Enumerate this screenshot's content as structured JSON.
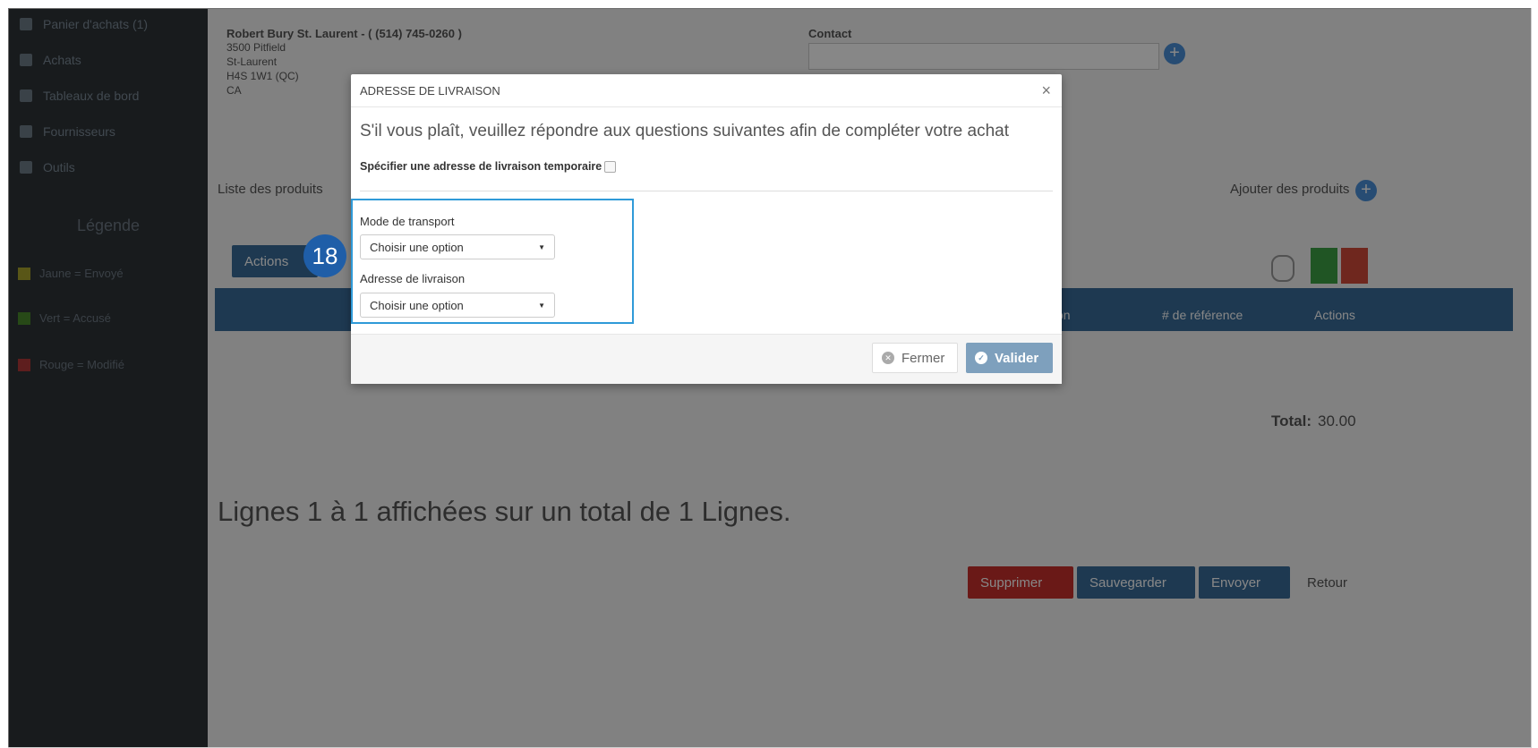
{
  "sidebar": {
    "items": [
      {
        "label": "Panier d'achats (1)",
        "icon": "cart-icon"
      },
      {
        "label": "Achats",
        "icon": "list-icon"
      },
      {
        "label": "Tableaux de bord",
        "icon": "dashboard-icon"
      },
      {
        "label": "Fournisseurs",
        "icon": "building-icon"
      },
      {
        "label": "Outils",
        "icon": "tools-icon"
      }
    ],
    "legend_title": "Légende",
    "legend": [
      {
        "label": "Jaune = Envoyé",
        "color": "#a8a22c"
      },
      {
        "label": "Vert = Accusé",
        "color": "#4a8a2c"
      },
      {
        "label": "Rouge = Modifié",
        "color": "#b23a3a"
      }
    ]
  },
  "background": {
    "supplier_name": "Robert Bury St. Laurent - ( (514) 745-0260 )",
    "supplier_address": [
      "3500 Pitfield",
      "St-Laurent",
      "H4S 1W1 (QC)",
      "CA"
    ],
    "contact_label": "Contact",
    "products_list_label": "Liste des produits",
    "add_products_label": "Ajouter des produits",
    "actions_label": "Actions",
    "col_reference": "# de référence",
    "col_actions": "Actions",
    "col_partial": "on",
    "total_label": "Total:",
    "total_value": "30.00",
    "lines_summary": "Lignes 1 à 1 affichées sur un total de 1 Lignes.",
    "delete_label": "Supprimer",
    "save_label": "Sauvegarder",
    "send_label": "Envoyer",
    "back_label": "Retour"
  },
  "modal": {
    "title": "ADRESSE DE LIVRAISON",
    "question": "S'il vous plaît, veuillez répondre aux questions suivantes afin de compléter votre achat",
    "temp_address_label": "Spécifier une adresse de livraison temporaire",
    "transport_label": "Mode de transport",
    "transport_value": "Choisir une option",
    "delivery_label": "Adresse de livraison",
    "delivery_value": "Choisir une option",
    "close_label": "Fermer",
    "validate_label": "Valider"
  },
  "annotation": {
    "step": "18"
  },
  "colors": {
    "accent": "#2f9ad8",
    "badge": "#1f5ea8",
    "validate": "#7ea0bd"
  }
}
